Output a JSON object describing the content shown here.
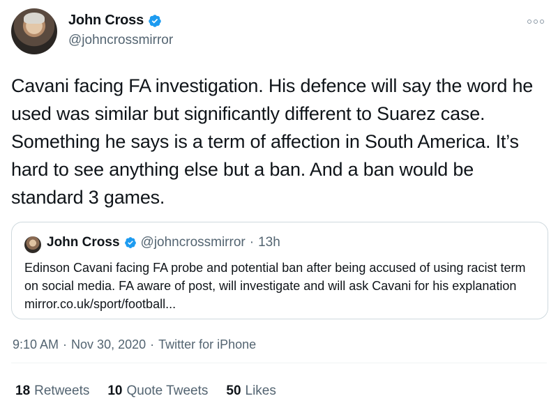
{
  "author": {
    "display_name": "John Cross",
    "handle": "@johncrossmirror"
  },
  "tweet": {
    "text": "Cavani facing FA investigation. His defence will say the word he used was similar but significantly different to Suarez case. Something he says is a term of affection in South America. It’s hard to see anything else but a ban. And a ban would be standard 3 games.",
    "time": "9:10 AM",
    "date": "Nov 30, 2020",
    "source": "Twitter for iPhone"
  },
  "quote": {
    "display_name": "John Cross",
    "handle": "@johncrossmirror",
    "age": "13h",
    "text": "Edinson Cavani facing FA probe and potential ban after being accused of using racist term on social media. FA aware of post, will investigate and will ask Cavani for his explanation  mirror.co.uk/sport/football..."
  },
  "stats": {
    "retweets_count": "18",
    "retweets_label": "Retweets",
    "quotes_count": "10",
    "quotes_label": "Quote Tweets",
    "likes_count": "50",
    "likes_label": "Likes"
  },
  "colors": {
    "verified": "#1d9bf0",
    "secondary_text": "#536471"
  },
  "icons": [
    "avatar",
    "verified-badge-icon",
    "more-options-icon"
  ]
}
